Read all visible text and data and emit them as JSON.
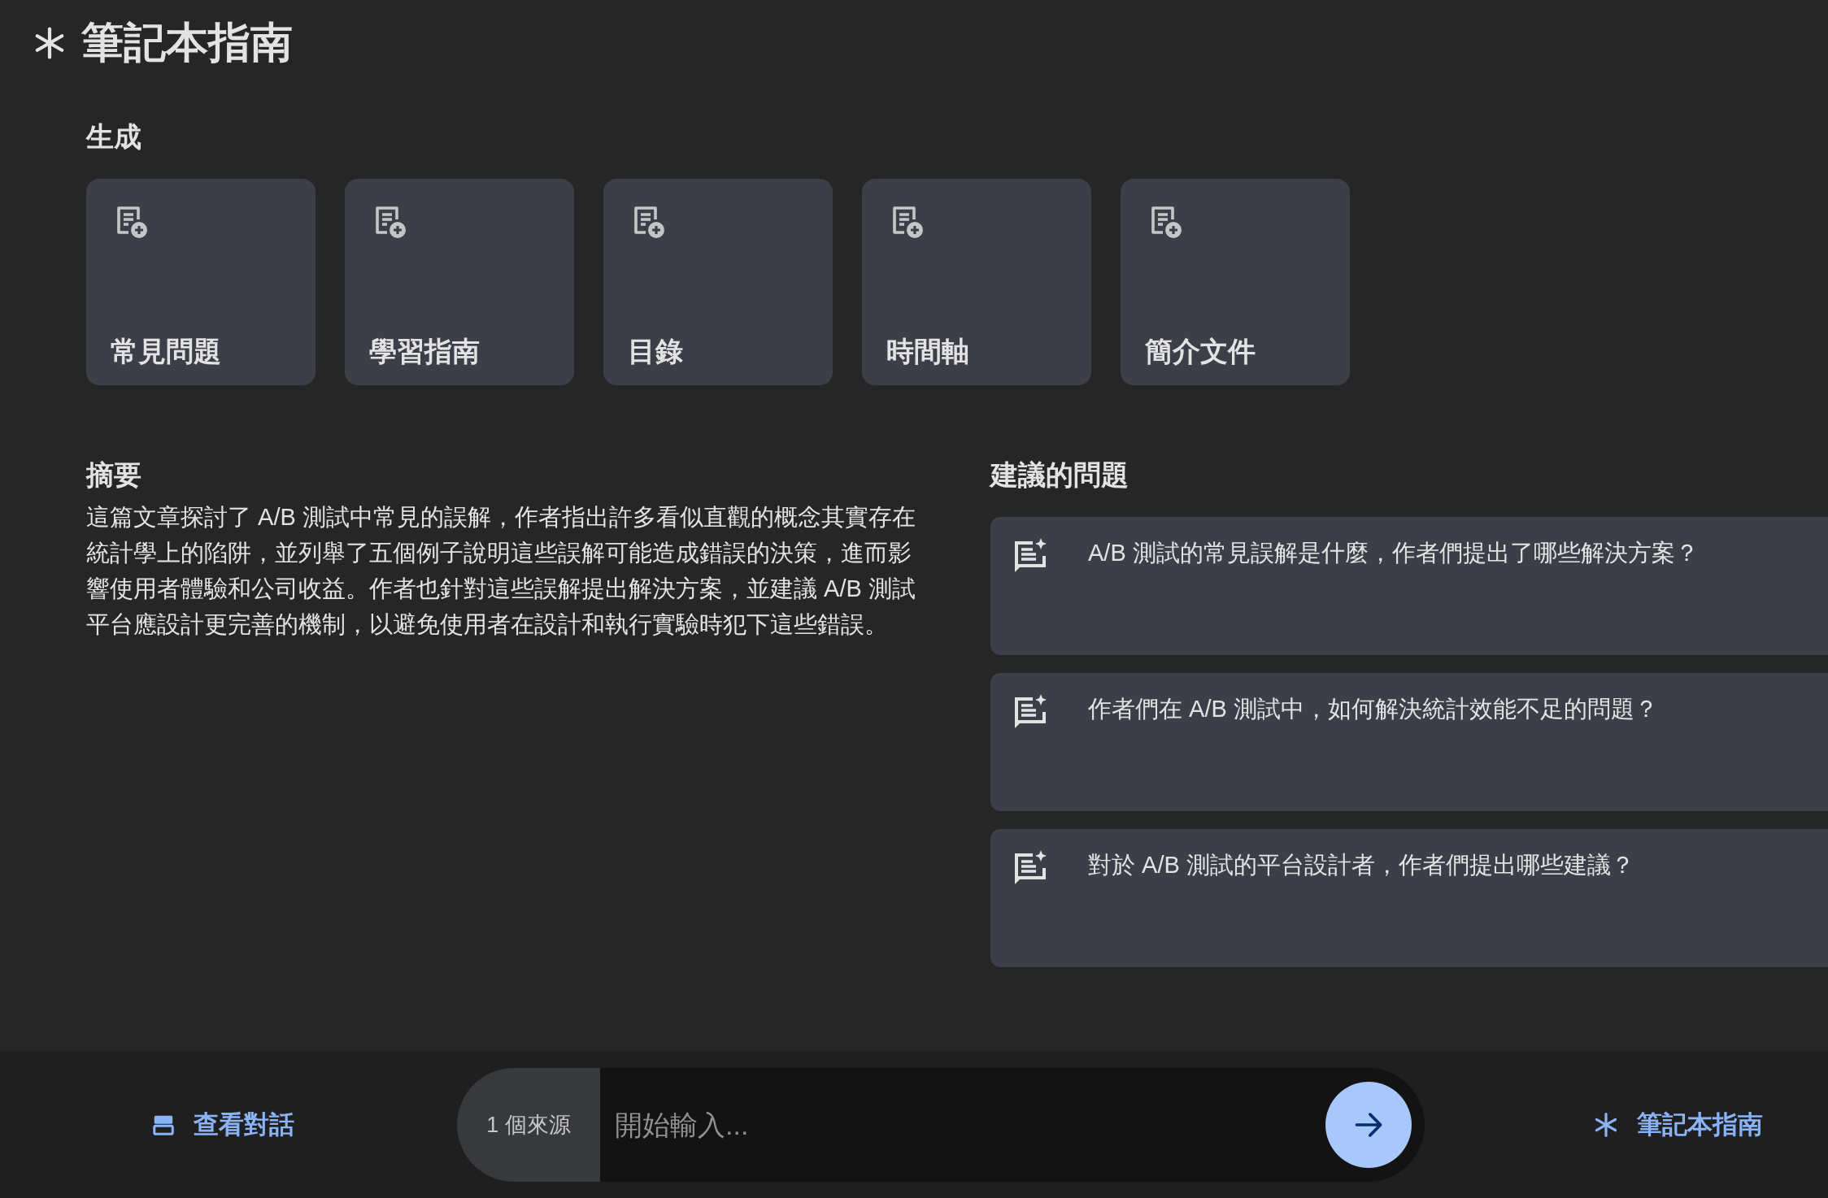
{
  "header": {
    "title": "筆記本指南"
  },
  "generate": {
    "heading": "生成",
    "cards": [
      {
        "label": "常見問題"
      },
      {
        "label": "學習指南"
      },
      {
        "label": "目錄"
      },
      {
        "label": "時間軸"
      },
      {
        "label": "簡介文件"
      }
    ]
  },
  "summary": {
    "heading": "摘要",
    "text": "這篇文章探討了 A/B 測試中常見的誤解，作者指出許多看似直觀的概念其實存在統計學上的陷阱，並列舉了五個例子說明這些誤解可能造成錯誤的決策，進而影響使用者體驗和公司收益。作者也針對這些誤解提出解決方案，並建議 A/B 測試平台應設計更完善的機制，以避免使用者在設計和執行實驗時犯下這些錯誤。"
  },
  "suggested_questions": {
    "heading": "建議的問題",
    "items": [
      {
        "text": "A/B 測試的常見誤解是什麼，作者們提出了哪些解決方案？"
      },
      {
        "text": "作者們在 A/B 測試中，如何解決統計效能不足的問題？"
      },
      {
        "text": "對於 A/B 測試的平台設計者，作者們提出哪些建議？"
      }
    ]
  },
  "bottom_bar": {
    "view_chat": "查看對話",
    "source_count": "1 個來源",
    "input": {
      "placeholder": "開始輸入..."
    },
    "guide_link": "筆記本指南"
  }
}
